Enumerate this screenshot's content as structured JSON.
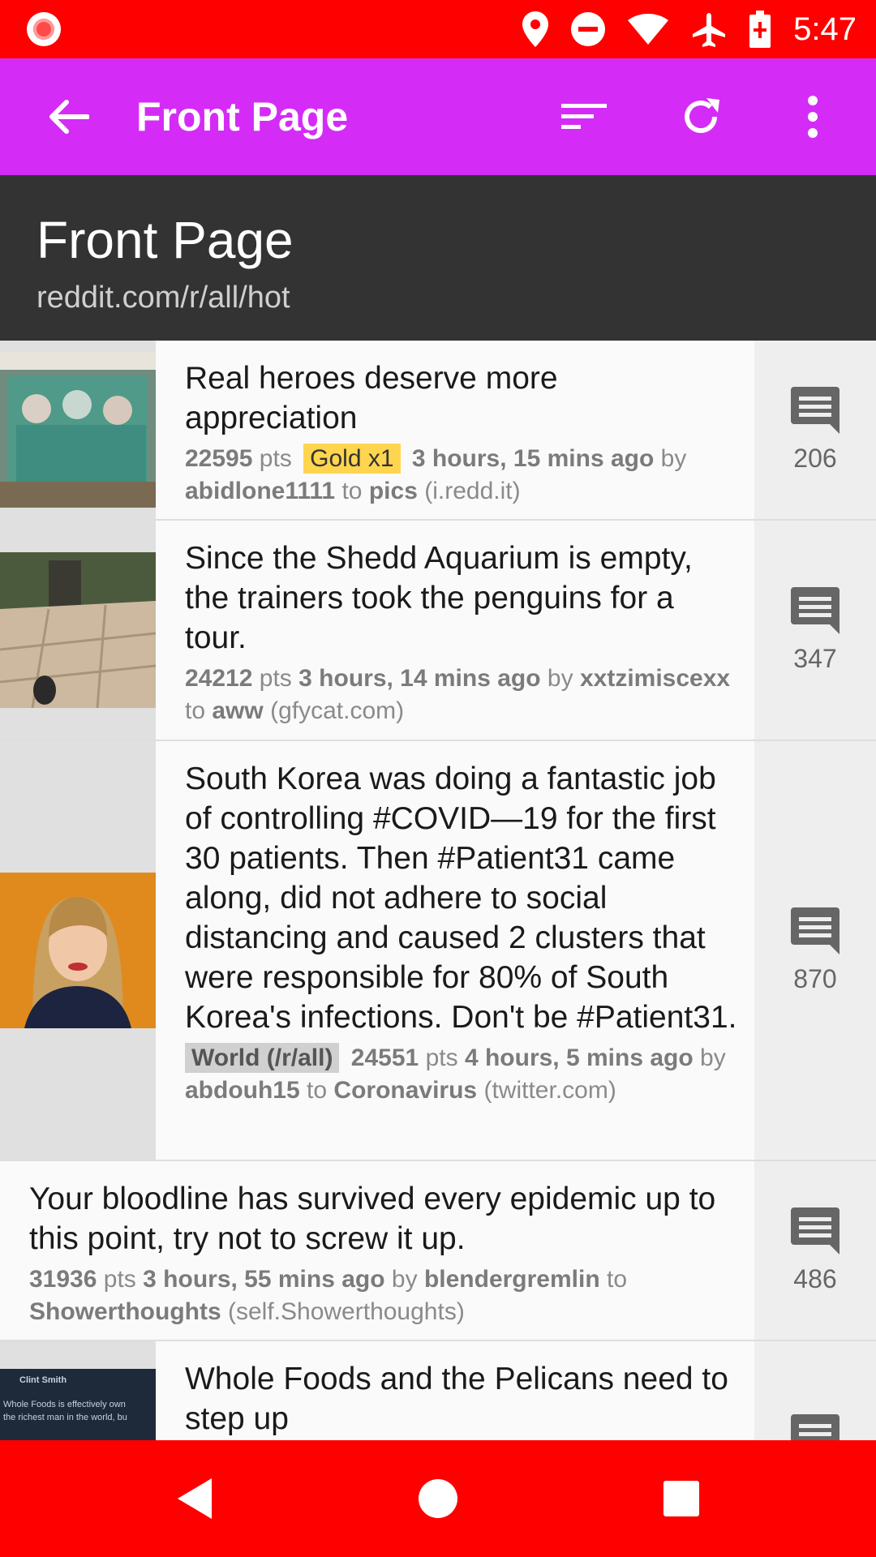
{
  "status_bar": {
    "time": "5:47",
    "icons": [
      "screen-record-icon",
      "location-icon",
      "do-not-disturb-icon",
      "wifi-icon",
      "airplane-mode-icon",
      "battery-icon"
    ]
  },
  "app_bar": {
    "title": "Front Page",
    "actions": [
      "back-arrow-icon",
      "sort-icon",
      "refresh-icon",
      "more-vert-icon"
    ]
  },
  "header": {
    "title": "Front Page",
    "subtitle": "reddit.com/r/all/hot"
  },
  "posts": [
    {
      "title": "Real heroes deserve more appreciation",
      "points": "22595",
      "pts_label": "pts",
      "gilded": "Gold x1",
      "time": "3 hours, 15 mins ago",
      "by": "by",
      "author": "abidlone1111",
      "to": "to",
      "subreddit": "pics",
      "domain": "(i.redd.it)",
      "comments": "206"
    },
    {
      "title": "Since the Shedd Aquarium is empty, the trainers took the penguins for a tour.",
      "points": "24212",
      "pts_label": "pts",
      "time": "3 hours, 14 mins ago",
      "by": "by",
      "author": "xxtzimiscexx",
      "to": "to",
      "subreddit": "aww",
      "domain": "(gfycat.com)",
      "comments": "347"
    },
    {
      "title": "South Korea was doing a fantastic job of controlling #COVID—19 for the first 30 patients. Then #Patient31 came along, did not adhere to social distancing and caused 2 clusters that were responsible for 80% of South Korea's infections. Don't be #Patient31.",
      "flair": "World (/r/all)",
      "points": "24551",
      "pts_label": "pts",
      "time": "4 hours, 5 mins ago",
      "by": "by",
      "author": "abdouh15",
      "to": "to",
      "subreddit": "Coronavirus",
      "domain": "(twitter.com)",
      "comments": "870"
    },
    {
      "title": "Your bloodline has survived every epidemic up to this point, try not to screw it up.",
      "points": "31936",
      "pts_label": "pts",
      "time": "3 hours, 55 mins ago",
      "by": "by",
      "author": "blendergremlin",
      "to": "to",
      "subreddit": "Showerthoughts",
      "domain": "(self.Showerthoughts)",
      "comments": "486"
    },
    {
      "title": "Whole Foods and the Pelicans need to step up",
      "thumb_text": [
        "Clint Smith",
        "Whole Foods is effectively own",
        "the richest man in the world, bu"
      ]
    }
  ],
  "nav_bar": {
    "icons": [
      "nav-back-icon",
      "nav-home-icon",
      "nav-recents-icon"
    ]
  }
}
